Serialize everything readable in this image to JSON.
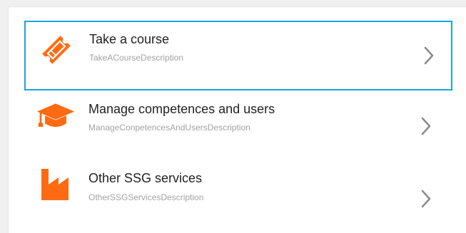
{
  "menu": {
    "items": [
      {
        "title": "Take a course",
        "description": "TakeACourseDescription",
        "icon": "ticket-icon",
        "selected": true
      },
      {
        "title": "Manage competences and users",
        "description": "ManageConpetencesAndUsersDescription",
        "icon": "graduation-cap-icon",
        "selected": false
      },
      {
        "title": "Other SSG services",
        "description": "OtherSSGServicesDescription",
        "icon": "factory-icon",
        "selected": false
      }
    ]
  },
  "colors": {
    "accent_orange": "#ff6a13",
    "selection_border": "#1aa3e0",
    "chevron": "#8c8c8c",
    "description_text": "#a3a3a3",
    "title_text": "#222222"
  }
}
